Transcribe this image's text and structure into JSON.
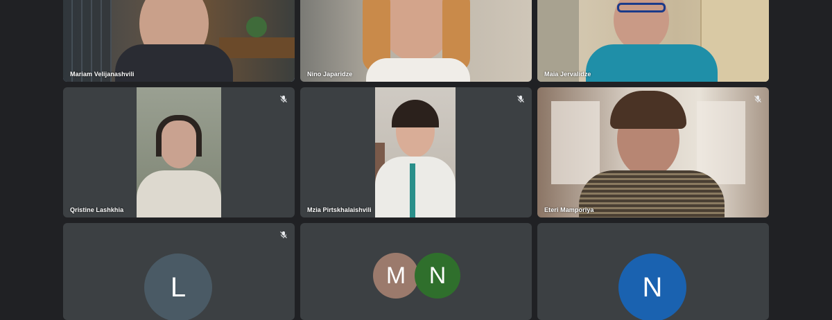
{
  "participants": [
    {
      "name": "Mariam Velijanashvili",
      "active_speaker": true
    },
    {
      "name": "Nino Japaridze"
    },
    {
      "name": "Maia Jervalidze"
    },
    {
      "name": "Qristine Lashkhia",
      "muted": true
    },
    {
      "name": "Mzia Pirtskhalaishvili",
      "muted": true
    },
    {
      "name": "Eteri Mamporiya",
      "muted": true
    },
    {
      "muted": true,
      "avatar_letter": "L",
      "avatar_color": "#4a5a65"
    },
    {
      "avatars": [
        {
          "letter": "M",
          "color": "#9b7a6c"
        },
        {
          "letter": "N",
          "color": "#2f6f2c"
        }
      ]
    },
    {
      "avatar_letter": "N",
      "avatar_color": "#1a62b0"
    }
  ],
  "icons": {
    "muted_mic": "mic-off-icon"
  }
}
